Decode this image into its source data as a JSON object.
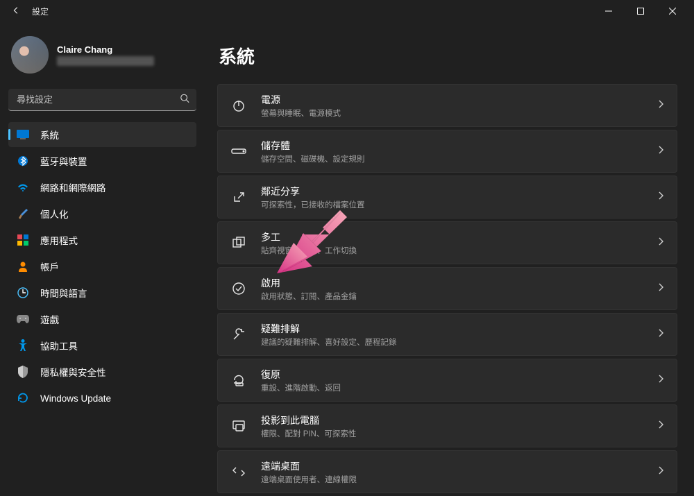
{
  "window": {
    "title": "設定"
  },
  "profile": {
    "name": "Claire Chang"
  },
  "search": {
    "placeholder": "尋找設定"
  },
  "nav": {
    "items": [
      {
        "label": "系統"
      },
      {
        "label": "藍牙與裝置"
      },
      {
        "label": "網路和網際網路"
      },
      {
        "label": "個人化"
      },
      {
        "label": "應用程式"
      },
      {
        "label": "帳戶"
      },
      {
        "label": "時間與語言"
      },
      {
        "label": "遊戲"
      },
      {
        "label": "協助工具"
      },
      {
        "label": "隱私權與安全性"
      },
      {
        "label": "Windows Update"
      }
    ]
  },
  "page": {
    "title": "系統",
    "tiles": [
      {
        "title": "電源",
        "sub": "螢幕與睡眠、電源模式"
      },
      {
        "title": "儲存體",
        "sub": "儲存空間、磁碟機、設定規則"
      },
      {
        "title": "鄰近分享",
        "sub": "可探索性，已接收的檔案位置"
      },
      {
        "title": "多工",
        "sub": "貼齊視窗、桌面、工作切換"
      },
      {
        "title": "啟用",
        "sub": "啟用狀態、訂閱、產品金鑰"
      },
      {
        "title": "疑難排解",
        "sub": "建議的疑難排解、喜好設定、歷程記錄"
      },
      {
        "title": "復原",
        "sub": "重設、進階啟動、返回"
      },
      {
        "title": "投影到此電腦",
        "sub": "權限、配對 PIN、可探索性"
      },
      {
        "title": "遠端桌面",
        "sub": "遠端桌面使用者、連線權限"
      }
    ]
  }
}
